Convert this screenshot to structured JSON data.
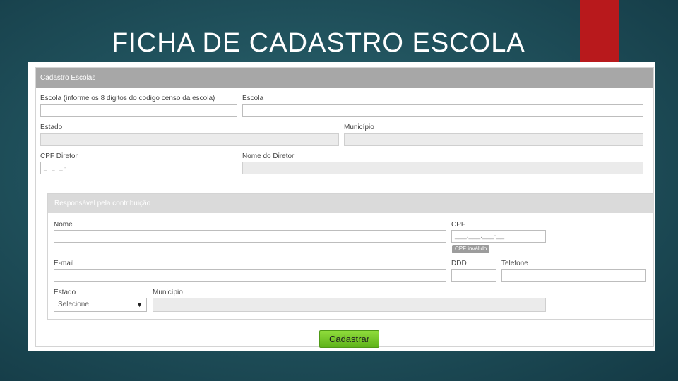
{
  "slide": {
    "title": "FICHA DE CADASTRO ESCOLA",
    "accent_color": "#b8191c",
    "background_color": "#21535e"
  },
  "form": {
    "header": "Cadastro Escolas",
    "fields": {
      "escola_codigo_label": "Escola (informe os 8 digitos do codigo censo da escola)",
      "escola_label": "Escola",
      "estado_label": "Estado",
      "municipio_label": "Município",
      "cpf_diretor_label": "CPF Diretor",
      "cpf_diretor_value": "_ . _ . _ -",
      "nome_diretor_label": "Nome do Diretor"
    },
    "responsavel": {
      "header": "Responsável pela contribuição",
      "nome_label": "Nome",
      "cpf_label": "CPF",
      "cpf_placeholder": "___.___.___-__",
      "cpf_error": "CPF inválido",
      "email_label": "E-mail",
      "ddd_label": "DDD",
      "telefone_label": "Telefone",
      "estado_label": "Estado",
      "estado_selected": "Selecione",
      "municipio_label": "Município"
    },
    "submit_label": "Cadastrar",
    "submit_color": "#6cbf24"
  }
}
